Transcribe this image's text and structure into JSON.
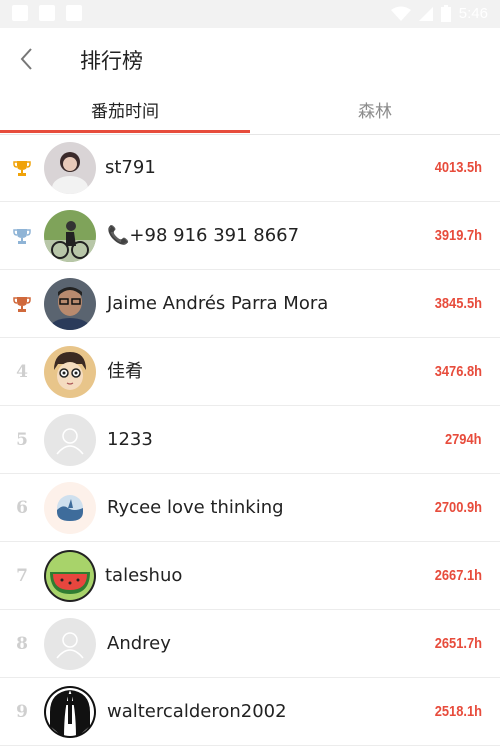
{
  "status_bar": {
    "time": "5:46"
  },
  "app_bar": {
    "title": "排行榜"
  },
  "tabs": [
    {
      "label": "番茄时间",
      "active": true
    },
    {
      "label": "森林",
      "active": false
    }
  ],
  "colors": {
    "accent": "#e74c3c",
    "gold": "#f0a30a",
    "silver": "#8fb4d6",
    "bronze": "#d0693c"
  },
  "leaderboard": [
    {
      "rank": "",
      "trophy": "gold-trophy-icon",
      "name": "st791",
      "hours": "4013.5h",
      "avatar": "photo-avatar"
    },
    {
      "rank": "",
      "trophy": "silver-trophy-icon",
      "name": "📞+98 916 391 8667",
      "hours": "3919.7h",
      "avatar": "photo-avatar"
    },
    {
      "rank": "",
      "trophy": "bronze-trophy-icon",
      "name": "Jaime Andrés Parra Mora",
      "hours": "3845.5h",
      "avatar": "photo-avatar"
    },
    {
      "rank": "4",
      "trophy": "",
      "name": "佳肴",
      "hours": "3476.8h",
      "avatar": "cartoon-avatar"
    },
    {
      "rank": "5",
      "trophy": "",
      "name": "1233",
      "hours": "2794h",
      "avatar": "default-avatar"
    },
    {
      "rank": "6",
      "trophy": "",
      "name": "Rycee love thinking",
      "hours": "2700.9h",
      "avatar": "wave-avatar"
    },
    {
      "rank": "7",
      "trophy": "",
      "name": "taleshuo",
      "hours": "2667.1h",
      "avatar": "watermelon-avatar"
    },
    {
      "rank": "8",
      "trophy": "",
      "name": "Andrey",
      "hours": "2651.7h",
      "avatar": "default-avatar"
    },
    {
      "rank": "9",
      "trophy": "",
      "name": "waltercalderon2002",
      "hours": "2518.1h",
      "avatar": "cross-avatar"
    }
  ]
}
